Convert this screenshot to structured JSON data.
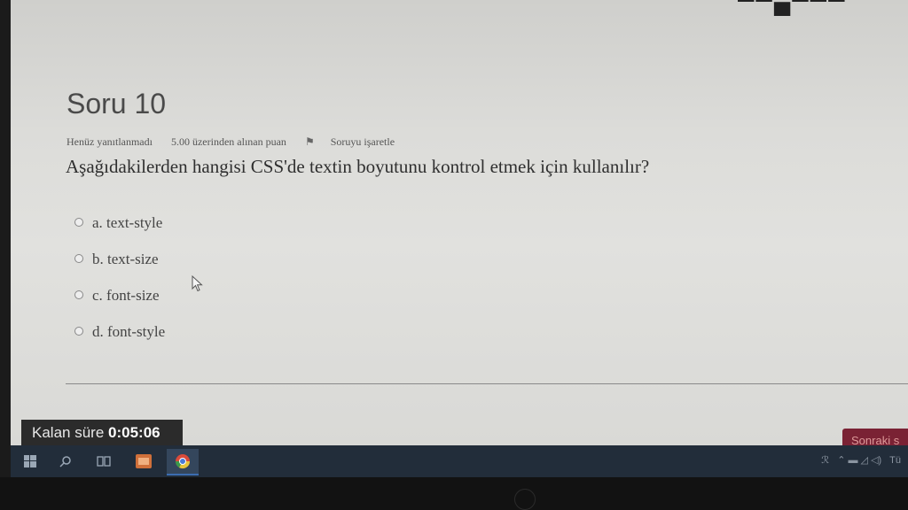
{
  "question": {
    "title": "Soru 10",
    "status": "Henüz yanıtlanmadı",
    "points": "5.00 üzerinden alınan puan",
    "flag_label": "Soruyu işaretle",
    "text": "Aşağıdakilerden hangisi CSS'de textin boyutunu kontrol etmek için kullanılır?"
  },
  "options": [
    {
      "label": "a. text-style"
    },
    {
      "label": "b. text-size"
    },
    {
      "label": "c. font-size"
    },
    {
      "label": "d. font-style"
    }
  ],
  "timer": {
    "label": "Kalan süre",
    "value": "0:05:06"
  },
  "next_button": {
    "label": "Sonraki s"
  },
  "colors": {
    "timer_bg": "#2b2b2b",
    "next_button_bg": "#7a2234",
    "taskbar_bg": "#222d3a",
    "chrome_active": "#3c6db0"
  },
  "taskbar": {
    "items": [
      "windows-icon",
      "search-icon",
      "task-view-icon",
      "app-icon",
      "chrome-icon"
    ]
  }
}
